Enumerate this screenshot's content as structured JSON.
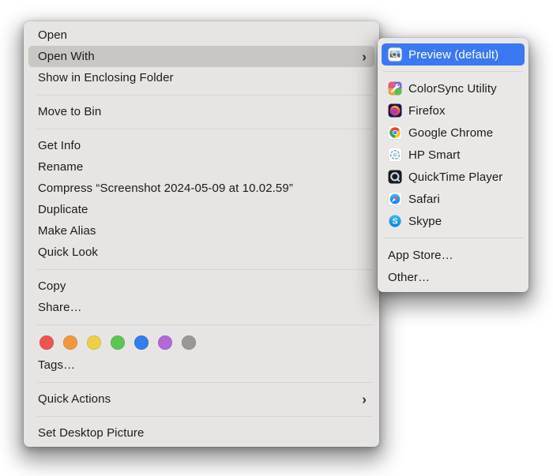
{
  "colors": {
    "menu_bg": "#e7e5e3",
    "submenu_bg": "#eae8e7",
    "hover_gray": "#c9c7c4",
    "selection_blue": "#3b79f3",
    "selection_text": "#ffffff",
    "text": "#1b1b1b",
    "separator": "#d7d5d2"
  },
  "context_menu": {
    "items": [
      {
        "type": "item",
        "label": "Open"
      },
      {
        "type": "item",
        "label": "Open With",
        "chevron": "›",
        "state": "highlighted"
      },
      {
        "type": "item",
        "label": "Show in Enclosing Folder"
      },
      {
        "type": "separator"
      },
      {
        "type": "item",
        "label": "Move to Bin"
      },
      {
        "type": "separator"
      },
      {
        "type": "item",
        "label": "Get Info"
      },
      {
        "type": "item",
        "label": "Rename"
      },
      {
        "type": "item",
        "label": "Compress “Screenshot 2024-05-09 at 10.02.59”"
      },
      {
        "type": "item",
        "label": "Duplicate"
      },
      {
        "type": "item",
        "label": "Make Alias"
      },
      {
        "type": "item",
        "label": "Quick Look"
      },
      {
        "type": "separator"
      },
      {
        "type": "item",
        "label": "Copy"
      },
      {
        "type": "item",
        "label": "Share…"
      },
      {
        "type": "separator"
      },
      {
        "type": "tags",
        "colors": [
          {
            "name": "Red",
            "hex": "#ee5450"
          },
          {
            "name": "Orange",
            "hex": "#f0973e"
          },
          {
            "name": "Yellow",
            "hex": "#eecf45"
          },
          {
            "name": "Green",
            "hex": "#5bc653"
          },
          {
            "name": "Blue",
            "hex": "#2e7ff0"
          },
          {
            "name": "Purple",
            "hex": "#b168d9"
          },
          {
            "name": "Grey",
            "hex": "#9a9896"
          }
        ]
      },
      {
        "type": "item",
        "label": "Tags…"
      },
      {
        "type": "separator"
      },
      {
        "type": "item",
        "label": "Quick Actions",
        "chevron": "›"
      },
      {
        "type": "separator"
      },
      {
        "type": "item",
        "label": "Set Desktop Picture"
      }
    ]
  },
  "open_with_submenu": {
    "items": [
      {
        "type": "item",
        "label": "Preview (default)",
        "icon": "preview-icon",
        "state": "selected"
      },
      {
        "type": "separator"
      },
      {
        "type": "item",
        "label": "ColorSync Utility",
        "icon": "colorsync-icon"
      },
      {
        "type": "item",
        "label": "Firefox",
        "icon": "firefox-icon"
      },
      {
        "type": "item",
        "label": "Google Chrome",
        "icon": "chrome-icon"
      },
      {
        "type": "item",
        "label": "HP Smart",
        "icon": "hp-smart-icon"
      },
      {
        "type": "item",
        "label": "QuickTime Player",
        "icon": "quicktime-icon"
      },
      {
        "type": "item",
        "label": "Safari",
        "icon": "safari-icon"
      },
      {
        "type": "item",
        "label": "Skype",
        "icon": "skype-icon"
      },
      {
        "type": "separator"
      },
      {
        "type": "item",
        "label": "App Store…"
      },
      {
        "type": "item",
        "label": "Other…"
      }
    ]
  }
}
